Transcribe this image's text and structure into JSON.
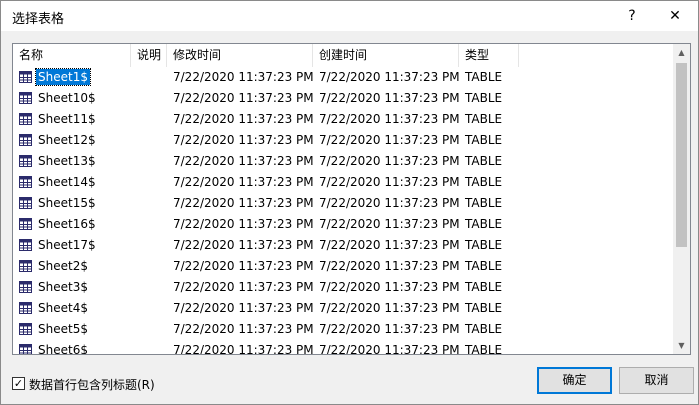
{
  "dialog": {
    "title": "选择表格",
    "help_glyph": "?",
    "close_glyph": "✕"
  },
  "columns": [
    "名称",
    "说明",
    "修改时间",
    "创建时间",
    "类型"
  ],
  "rows": [
    {
      "name": "Sheet1$",
      "desc": "",
      "modified": "7/22/2020 11:37:23 PM",
      "created": "7/22/2020 11:37:23 PM",
      "type": "TABLE",
      "selected": true
    },
    {
      "name": "Sheet10$",
      "desc": "",
      "modified": "7/22/2020 11:37:23 PM",
      "created": "7/22/2020 11:37:23 PM",
      "type": "TABLE"
    },
    {
      "name": "Sheet11$",
      "desc": "",
      "modified": "7/22/2020 11:37:23 PM",
      "created": "7/22/2020 11:37:23 PM",
      "type": "TABLE"
    },
    {
      "name": "Sheet12$",
      "desc": "",
      "modified": "7/22/2020 11:37:23 PM",
      "created": "7/22/2020 11:37:23 PM",
      "type": "TABLE"
    },
    {
      "name": "Sheet13$",
      "desc": "",
      "modified": "7/22/2020 11:37:23 PM",
      "created": "7/22/2020 11:37:23 PM",
      "type": "TABLE"
    },
    {
      "name": "Sheet14$",
      "desc": "",
      "modified": "7/22/2020 11:37:23 PM",
      "created": "7/22/2020 11:37:23 PM",
      "type": "TABLE"
    },
    {
      "name": "Sheet15$",
      "desc": "",
      "modified": "7/22/2020 11:37:23 PM",
      "created": "7/22/2020 11:37:23 PM",
      "type": "TABLE"
    },
    {
      "name": "Sheet16$",
      "desc": "",
      "modified": "7/22/2020 11:37:23 PM",
      "created": "7/22/2020 11:37:23 PM",
      "type": "TABLE"
    },
    {
      "name": "Sheet17$",
      "desc": "",
      "modified": "7/22/2020 11:37:23 PM",
      "created": "7/22/2020 11:37:23 PM",
      "type": "TABLE"
    },
    {
      "name": "Sheet2$",
      "desc": "",
      "modified": "7/22/2020 11:37:23 PM",
      "created": "7/22/2020 11:37:23 PM",
      "type": "TABLE"
    },
    {
      "name": "Sheet3$",
      "desc": "",
      "modified": "7/22/2020 11:37:23 PM",
      "created": "7/22/2020 11:37:23 PM",
      "type": "TABLE"
    },
    {
      "name": "Sheet4$",
      "desc": "",
      "modified": "7/22/2020 11:37:23 PM",
      "created": "7/22/2020 11:37:23 PM",
      "type": "TABLE"
    },
    {
      "name": "Sheet5$",
      "desc": "",
      "modified": "7/22/2020 11:37:23 PM",
      "created": "7/22/2020 11:37:23 PM",
      "type": "TABLE"
    },
    {
      "name": "Sheet6$",
      "desc": "",
      "modified": "7/22/2020 11:37:23 PM",
      "created": "7/22/2020 11:37:23 PM",
      "type": "TABLE"
    }
  ],
  "footer": {
    "checkbox_label": "数据首行包含列标题(R)",
    "checkbox_checked": true,
    "check_glyph": "✓",
    "ok_label": "确定",
    "cancel_label": "取消"
  },
  "scrollbar": {
    "up_glyph": "▲",
    "down_glyph": "▼"
  },
  "icons": {
    "table": "table-icon"
  },
  "colors": {
    "selection": "#0078d7",
    "default_button_border": "#0078d7"
  }
}
